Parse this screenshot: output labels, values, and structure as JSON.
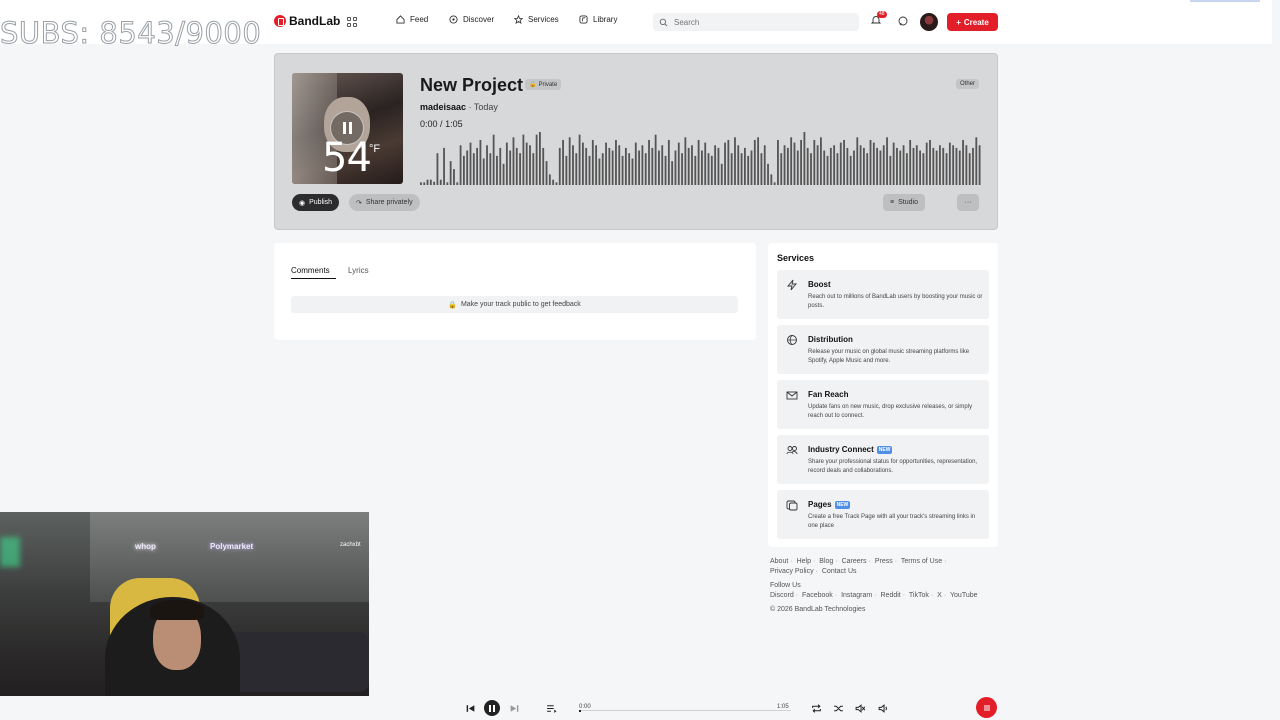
{
  "overlay": {
    "subs_text": "SUBS: 8543/9000"
  },
  "nav": {
    "logo": "BandLab",
    "items": [
      "Feed",
      "Discover",
      "Services",
      "Library"
    ],
    "search_placeholder": "Search",
    "notification_count": "48",
    "create_label": "Create"
  },
  "project": {
    "title": "New Project",
    "visibility": "Private",
    "genre": "Other",
    "artist": "madeisaac",
    "date": "· Today",
    "current_time": "0:00",
    "separator": "/",
    "duration": "1:05",
    "cover_temp": "54",
    "cover_unit": "°F",
    "publish_label": "Publish",
    "share_label": "Share privately",
    "studio_label": "Studio",
    "more_label": "···",
    "waveform": [
      0.05,
      0.05,
      0.1,
      0.1,
      0.06,
      0.6,
      0.1,
      0.7,
      0.05,
      0.45,
      0.3,
      0.05,
      0.75,
      0.55,
      0.65,
      0.8,
      0.6,
      0.7,
      0.85,
      0.5,
      0.75,
      0.6,
      0.95,
      0.55,
      0.7,
      0.4,
      0.8,
      0.65,
      0.9,
      0.7,
      0.6,
      0.95,
      0.8,
      0.75,
      0.6,
      0.95,
      1.0,
      0.7,
      0.45,
      0.2,
      0.1,
      0.05,
      0.7,
      0.85,
      0.55,
      0.9,
      0.75,
      0.6,
      0.95,
      0.8,
      0.7,
      0.55,
      0.85,
      0.75,
      0.5,
      0.6,
      0.8,
      0.7,
      0.65,
      0.85,
      0.75,
      0.55,
      0.7,
      0.6,
      0.5,
      0.8,
      0.65,
      0.75,
      0.6,
      0.85,
      0.7,
      0.95,
      0.65,
      0.75,
      0.55,
      0.85,
      0.45,
      0.65,
      0.8,
      0.6,
      0.9,
      0.7,
      0.75,
      0.55,
      0.85,
      0.65,
      0.8,
      0.6,
      0.55,
      0.75,
      0.7,
      0.4,
      0.8,
      0.85,
      0.6,
      0.9,
      0.75,
      0.6,
      0.7,
      0.55,
      0.65,
      0.85,
      0.9,
      0.6,
      0.75,
      0.4,
      0.2,
      0.05,
      0.85,
      0.6,
      0.75,
      0.7,
      0.9,
      0.8,
      0.65,
      0.85,
      1.0,
      0.7,
      0.6,
      0.85,
      0.75,
      0.9,
      0.65,
      0.55,
      0.7,
      0.75,
      0.6,
      0.8,
      0.85,
      0.7,
      0.55,
      0.65,
      0.9,
      0.75,
      0.7,
      0.6,
      0.85,
      0.8,
      0.7,
      0.65,
      0.75,
      0.9,
      0.55,
      0.8,
      0.7,
      0.65,
      0.75,
      0.6,
      0.85,
      0.7,
      0.75,
      0.65,
      0.6,
      0.8,
      0.85,
      0.7,
      0.65,
      0.75,
      0.7,
      0.6,
      0.8,
      0.75,
      0.7,
      0.65,
      0.85,
      0.75,
      0.6,
      0.7,
      0.9,
      0.75
    ]
  },
  "comments": {
    "tabs": [
      "Comments",
      "Lyrics"
    ],
    "notice": "Make your track public to get feedback"
  },
  "services": {
    "heading": "Services",
    "items": [
      {
        "name": "Boost",
        "desc": "Reach out to millions of BandLab users by boosting your music or posts.",
        "icon": "bolt-icon",
        "is_new": false
      },
      {
        "name": "Distribution",
        "desc": "Release your music on global music streaming platforms like Spotify, Apple Music and more.",
        "icon": "globe-icon",
        "is_new": false
      },
      {
        "name": "Fan Reach",
        "desc": "Update fans on new music, drop exclusive releases, or simply reach out to connect.",
        "icon": "mail-icon",
        "is_new": false
      },
      {
        "name": "Industry Connect",
        "desc": "Share your professional status for opportunities, representation, record deals and collaborations.",
        "icon": "people-icon",
        "is_new": true
      },
      {
        "name": "Pages",
        "desc": "Create a free Track Page with all your track's streaming links in one place",
        "icon": "pages-icon",
        "is_new": true
      }
    ],
    "new_label": "NEW"
  },
  "footer": {
    "links_row1": [
      "About",
      "Help",
      "Blog",
      "Careers",
      "Press",
      "Terms of Use"
    ],
    "links_row2": [
      "Privacy Policy",
      "Contact Us"
    ],
    "follow_label": "Follow Us",
    "social": [
      "Discord",
      "Facebook",
      "Instagram",
      "Reddit",
      "TikTok",
      "X",
      "YouTube"
    ],
    "copyright": "© 2026 BandLab Technologies"
  },
  "webcam": {
    "sign1": "whop",
    "sign2": "Polymarket",
    "sign3": "zachxbt"
  },
  "player": {
    "current_time": "0:00",
    "duration": "1:05",
    "progress": 0.01
  },
  "colors": {
    "accent": "#e21e28",
    "new_badge": "#4f8fe8",
    "card_bg": "#d7d8da"
  }
}
